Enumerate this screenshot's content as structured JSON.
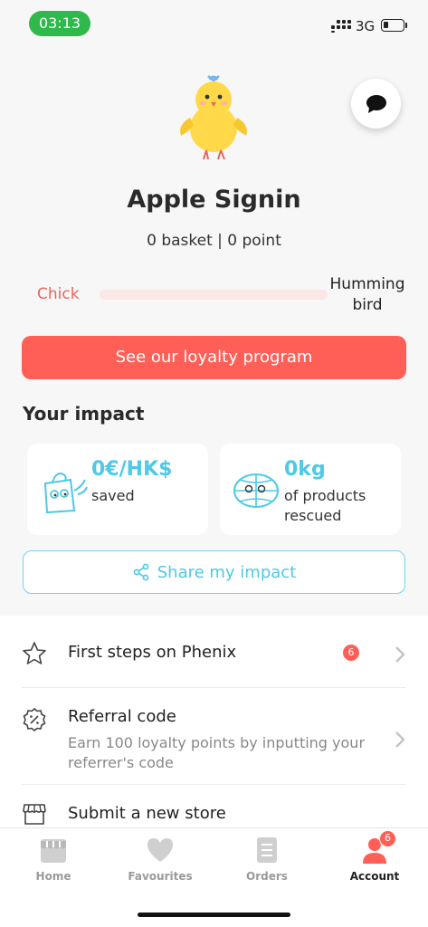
{
  "status_bar": {
    "time": "03:13",
    "network": "3G"
  },
  "profile": {
    "name": "Apple Signin",
    "stats": "0 basket | 0 point",
    "level_current": "Chick",
    "level_next_line1": "Humming",
    "level_next_line2": "bird",
    "progress_fraction": 0.0
  },
  "loyalty_button": "See our loyalty program",
  "impact": {
    "title": "Your impact",
    "money": {
      "value": "0€/HK$",
      "label": "saved"
    },
    "products": {
      "value": "0kg",
      "label_line1": "of products",
      "label_line2": "rescued"
    },
    "share_label": "Share my impact"
  },
  "menu": {
    "first_steps": {
      "title": "First steps on Phenix",
      "badge": "6"
    },
    "referral": {
      "title": "Referral code",
      "subtitle": "Earn 100 loyalty points by inputting your referrer's code"
    },
    "submit_store": {
      "title": "Submit a new store"
    }
  },
  "tabs": {
    "home": "Home",
    "favourites": "Favourites",
    "orders": "Orders",
    "account": "Account",
    "account_badge": "6"
  },
  "colors": {
    "accent": "#ff5f57",
    "impact_blue": "#4ec9e6",
    "status_green": "#2fb84b"
  }
}
